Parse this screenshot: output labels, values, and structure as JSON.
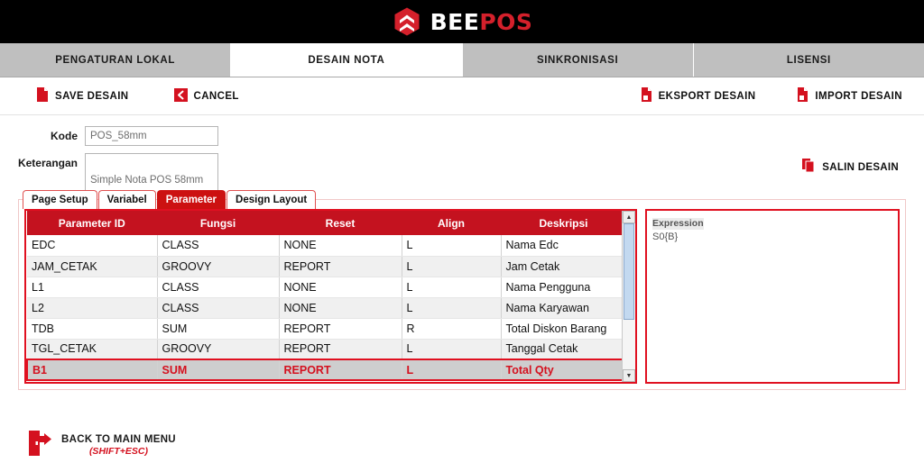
{
  "header": {
    "logo_icon": "beepos-hexagon-logo-icon",
    "brand_first": "BEE",
    "brand_second": "POS"
  },
  "tabs": [
    {
      "label": "PENGATURAN LOKAL",
      "active": false
    },
    {
      "label": "DESAIN NOTA",
      "active": true
    },
    {
      "label": "SINKRONISASI",
      "active": false
    },
    {
      "label": "LISENSI",
      "active": false
    }
  ],
  "toolbar": {
    "save_label": "SAVE DESAIN",
    "save_icon": "document-icon",
    "cancel_label": "CANCEL",
    "cancel_icon": "back-arrow-icon",
    "export_label": "EKSPORT DESAIN",
    "export_icon": "document-export-icon",
    "import_label": "IMPORT DESAIN",
    "import_icon": "document-import-icon"
  },
  "form": {
    "kode_label": "Kode",
    "kode_value": "POS_58mm",
    "keterangan_label": "Keterangan",
    "keterangan_value": "Simple Nota POS 58mm",
    "salin_label": "SALIN DESAIN",
    "salin_icon": "copy-document-icon"
  },
  "subtabs": [
    {
      "label": "Page Setup",
      "active": false
    },
    {
      "label": "Variabel",
      "active": false
    },
    {
      "label": "Parameter",
      "active": true
    },
    {
      "label": "Design Layout",
      "active": false
    }
  ],
  "table": {
    "columns": [
      "Parameter ID",
      "Fungsi",
      "Reset",
      "Align",
      "Deskripsi"
    ],
    "rows": [
      {
        "id": "EDC",
        "fungsi": "CLASS",
        "reset": "NONE",
        "align": "L",
        "deskripsi": "Nama Edc",
        "selected": false
      },
      {
        "id": "JAM_CETAK",
        "fungsi": "GROOVY",
        "reset": "REPORT",
        "align": "L",
        "deskripsi": "Jam Cetak",
        "selected": false
      },
      {
        "id": "L1",
        "fungsi": "CLASS",
        "reset": "NONE",
        "align": "L",
        "deskripsi": "Nama Pengguna",
        "selected": false
      },
      {
        "id": "L2",
        "fungsi": "CLASS",
        "reset": "NONE",
        "align": "L",
        "deskripsi": "Nama Karyawan",
        "selected": false
      },
      {
        "id": "TDB",
        "fungsi": "SUM",
        "reset": "REPORT",
        "align": "R",
        "deskripsi": "Total Diskon Barang",
        "selected": false
      },
      {
        "id": "TGL_CETAK",
        "fungsi": "GROOVY",
        "reset": "REPORT",
        "align": "L",
        "deskripsi": "Tanggal Cetak",
        "selected": false
      },
      {
        "id": "B1",
        "fungsi": "SUM",
        "reset": "REPORT",
        "align": "L",
        "deskripsi": "Total Qty",
        "selected": true
      }
    ],
    "scroll_up_icon": "scroll-up-arrow-icon",
    "scroll_down_icon": "scroll-down-arrow-icon"
  },
  "expression": {
    "label": "Expression",
    "value": "S0{B}"
  },
  "footer": {
    "label": "BACK TO MAIN MENU",
    "shortcut": "(SHIFT+ESC)",
    "icon": "exit-door-icon"
  },
  "colors": {
    "brand_red": "#d4202b",
    "header_black": "#000000",
    "tabstrip_gray": "#bfbfbf",
    "table_header_red": "#c4121f",
    "accent_border_red": "#e01020",
    "selected_row_bg": "#cecece"
  }
}
